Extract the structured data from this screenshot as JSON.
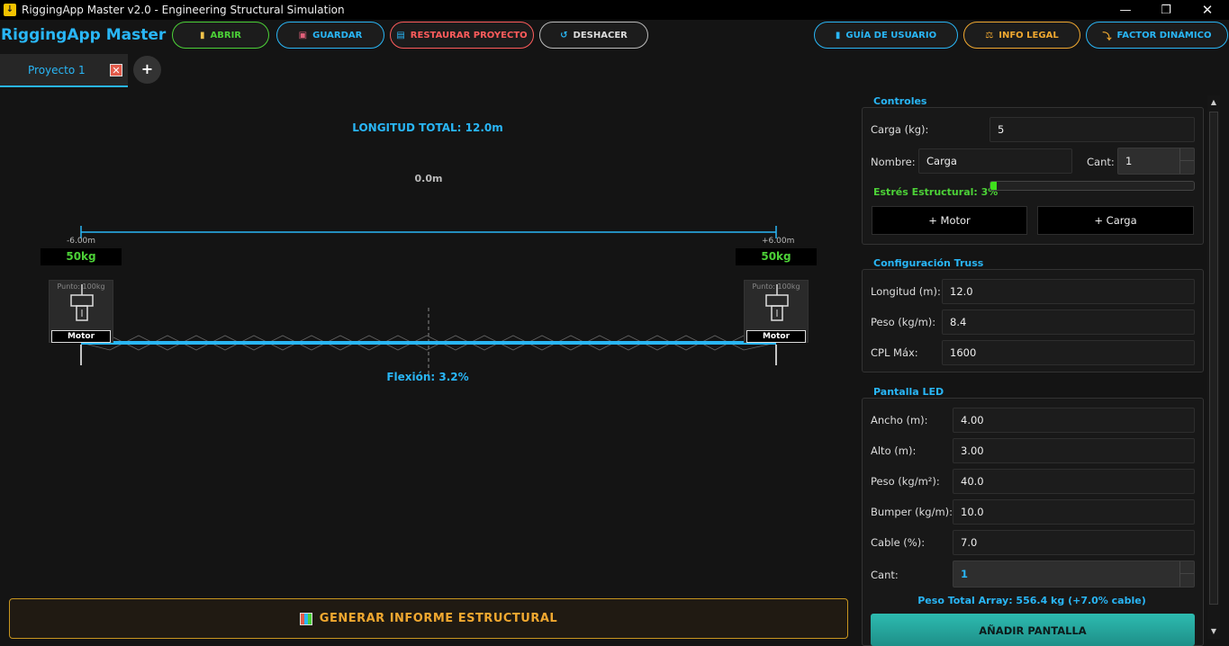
{
  "window": {
    "title": "RiggingApp Master v2.0 - Engineering Structural Simulation"
  },
  "header": {
    "brand": "RiggingApp Master",
    "buttons": [
      {
        "label": "ABRIR",
        "icon": "folder-icon",
        "color": "#4cd137"
      },
      {
        "label": "GUARDAR",
        "icon": "floppy-icon",
        "color": "#29b6f6"
      },
      {
        "label": "RESTAURAR PROYECTO",
        "icon": "restore-icon",
        "color": "#ff5c5c"
      },
      {
        "label": "DESHACER",
        "icon": "undo-icon",
        "color": "#cccccc"
      },
      {
        "label": "GUÍA DE USUARIO",
        "icon": "book-icon",
        "color": "#29b6f6"
      },
      {
        "label": "INFO LEGAL",
        "icon": "scale-icon",
        "color": "#f0a830"
      },
      {
        "label": "FACTOR DINÁMICO",
        "icon": "bolt-icon",
        "color": "#29b6f6"
      }
    ]
  },
  "tabs": {
    "active": "Proyecto 1",
    "add": "+"
  },
  "canvas": {
    "total_length_label": "LONGITUD TOTAL: 12.0m",
    "left_dim": "-6.00m",
    "right_dim": "+6.00m",
    "left_load": "50kg",
    "right_load": "50kg",
    "center_label": "0.0m",
    "left_point": "Punto: 100kg",
    "right_point": "Punto: 100kg",
    "motor_label": "Motor",
    "flexion_label": "Flexión: 3.2%"
  },
  "report_button": {
    "label": "GENERAR INFORME ESTRUCTURAL",
    "icon": "report-icon"
  },
  "controles": {
    "title": "Controles",
    "carga_label": "Carga (kg):",
    "carga_value": "5",
    "nombre_label": "Nombre:",
    "nombre_value": "Carga",
    "cant_label": "Cant:",
    "cant_value": "1",
    "stress_label": "Estrés Estructural: 3%",
    "stress_fraction": 0.03,
    "add_motor": "+ Motor",
    "add_carga": "+ Carga"
  },
  "truss": {
    "title": "Configuración Truss",
    "longitud_label": "Longitud (m):",
    "longitud_value": "12.0",
    "peso_label": "Peso (kg/m):",
    "peso_value": "8.4",
    "cpl_label": "CPL Máx:",
    "cpl_value": "1600"
  },
  "led": {
    "title": "Pantalla LED",
    "ancho_label": "Ancho (m):",
    "ancho_value": "4.00",
    "alto_label": "Alto (m):",
    "alto_value": "3.00",
    "peso_label": "Peso (kg/m²):",
    "peso_value": "40.0",
    "bumper_label": "Bumper (kg/m):",
    "bumper_value": "10.0",
    "cable_label": "Cable (%):",
    "cable_value": "7.0",
    "cant_label": "Cant:",
    "cant_value": "1",
    "total_label": "Peso Total Array: 556.4 kg (+7.0% cable)",
    "add_button": "AÑADIR PANTALLA"
  }
}
